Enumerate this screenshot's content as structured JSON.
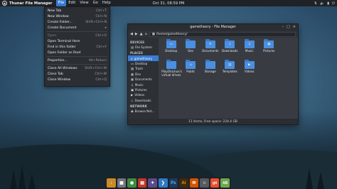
{
  "top_panel": {
    "app_name": "Thunar File Manager",
    "menus": [
      "File",
      "Edit",
      "View",
      "Go",
      "Help"
    ],
    "active_menu": "File",
    "clock": "Oct 31, 08:59 PM"
  },
  "file_menu": {
    "items": [
      {
        "label": "New Tab",
        "shortcut": "Ctrl+T",
        "disabled": false
      },
      {
        "label": "New Window",
        "shortcut": "Ctrl+N",
        "disabled": false
      },
      {
        "label": "Create Folder...",
        "shortcut": "Shift+Ctrl+N",
        "disabled": false
      },
      {
        "label": "Create Document",
        "shortcut": "▸",
        "disabled": false
      },
      {
        "label": "Open",
        "shortcut": "Ctrl+O",
        "disabled": true
      },
      {
        "label": "Open Terminal Here",
        "shortcut": "",
        "disabled": false
      },
      {
        "label": "Find in this folder",
        "shortcut": "Ctrl+F",
        "disabled": false
      },
      {
        "label": "Open Folder as Root",
        "shortcut": "",
        "disabled": false
      },
      {
        "label": "Properties...",
        "shortcut": "Alt+Return",
        "disabled": false
      },
      {
        "label": "Close All Windows",
        "shortcut": "Shift+Ctrl+W",
        "disabled": false
      },
      {
        "label": "Close Tab",
        "shortcut": "Ctrl+W",
        "disabled": false
      },
      {
        "label": "Close Window",
        "shortcut": "Ctrl+Q",
        "disabled": false
      }
    ]
  },
  "file_manager": {
    "title": "gametheory - File Manager",
    "path": "/home/gametheory/",
    "sidebar": {
      "devices_header": "DEVICES",
      "devices": [
        "File System"
      ],
      "places_header": "PLACES",
      "places": [
        "gametheory",
        "Desktop",
        "Trash",
        "Dev",
        "Documents",
        "Music",
        "Pictures",
        "Videos",
        "Downloads"
      ],
      "selected_place": "gametheory",
      "network_header": "NETWORK",
      "network": [
        "Browse Net..."
      ]
    },
    "files": [
      {
        "name": "Desktop",
        "glyph": "▭"
      },
      {
        "name": "Dev",
        "glyph": ""
      },
      {
        "name": "Documents",
        "glyph": "≡"
      },
      {
        "name": "Downloads",
        "glyph": "↓"
      },
      {
        "name": "Music",
        "glyph": "♫"
      },
      {
        "name": "Pictures",
        "glyph": "▣"
      },
      {
        "name": "PlayOnLinux's virtual drives",
        "glyph": ""
      },
      {
        "name": "Public",
        "glyph": "⌂"
      },
      {
        "name": "Storage",
        "glyph": ""
      },
      {
        "name": "Templates",
        "glyph": "▤"
      },
      {
        "name": "Videos",
        "glyph": "▶"
      }
    ],
    "status": "11 items, Free space: 224.4 GB"
  },
  "dock": {
    "apps": [
      {
        "name": "installer-icon",
        "label": "↓",
        "color": "#c98a2a"
      },
      {
        "name": "files-icon",
        "label": "▦",
        "color": "#6f7780"
      },
      {
        "name": "chrome-icon",
        "label": "◉",
        "color": "#3c8d3f"
      },
      {
        "name": "pdf-icon",
        "label": "▤",
        "color": "#c0392b"
      },
      {
        "name": "git-gui-icon",
        "label": "✦",
        "color": "#5a4a8a"
      },
      {
        "name": "code-icon",
        "label": "❯",
        "color": "#2f79c5"
      },
      {
        "name": "photoshop-icon",
        "label": "Ps",
        "color": "#1c3a5e"
      },
      {
        "name": "illustrator-icon",
        "label": "Ai",
        "color": "#3d2a12"
      },
      {
        "name": "mail-icon",
        "label": "✉",
        "color": "#d35400"
      },
      {
        "name": "chat-icon",
        "label": "☺",
        "color": "#555a60"
      },
      {
        "name": "git-icon",
        "label": "git",
        "color": "#e84e31"
      },
      {
        "name": "ab-icon",
        "label": "AB",
        "color": "#6aa84f"
      }
    ]
  }
}
